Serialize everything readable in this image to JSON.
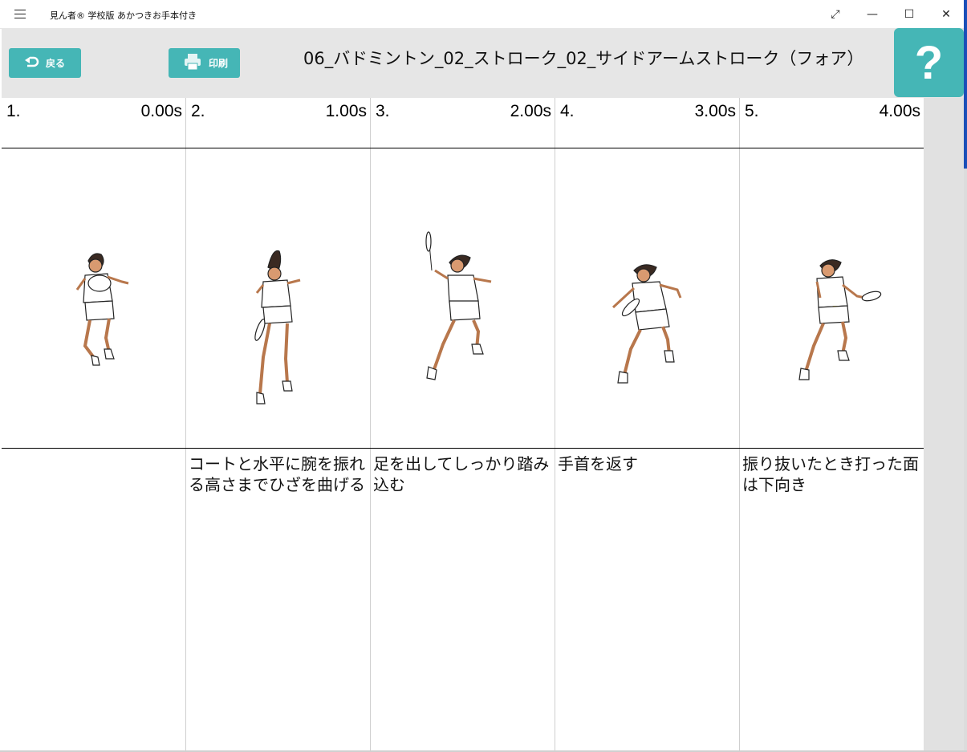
{
  "window": {
    "title": "見ん者® 学校版 あかつきお手本付き",
    "controls": {
      "fullscreen": "⤢",
      "minimize": "—",
      "maximize": "☐",
      "close": "✕"
    }
  },
  "toolbar": {
    "back_label": "戻る",
    "print_label": "印刷",
    "page_title": "06_バドミントン_02_ストローク_02_サイドアームストローク（フォア）",
    "help_label": "?"
  },
  "frames": [
    {
      "num": "1.",
      "time": "0.00s",
      "desc": ""
    },
    {
      "num": "2.",
      "time": "1.00s",
      "desc": "コートと水平に腕を振れる高さまでひざを曲げる"
    },
    {
      "num": "3.",
      "time": "2.00s",
      "desc": "足を出してしっかり踏み込む"
    },
    {
      "num": "4.",
      "time": "3.00s",
      "desc": "手首を返す"
    },
    {
      "num": "5.",
      "time": "4.00s",
      "desc": "振り抜いたとき打った面は下向き"
    }
  ],
  "colors": {
    "accent": "#45b6b6",
    "toolbar_bg": "#e6e6e6",
    "side_pane": "#e1e1e1"
  }
}
